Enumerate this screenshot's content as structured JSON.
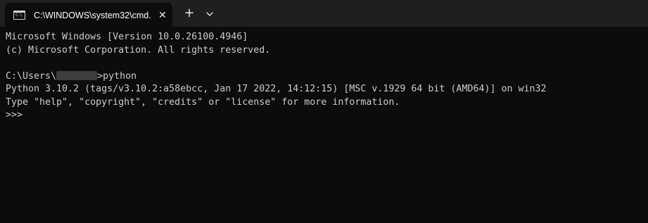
{
  "tab": {
    "title": "C:\\WINDOWS\\system32\\cmd.",
    "icon": "command-prompt-icon",
    "close_symbol": "✕"
  },
  "tabbar": {
    "new_tab_symbol": "+",
    "dropdown_icon": "chevron-down-icon"
  },
  "console": {
    "banner_line1": "Microsoft Windows [Version 10.0.26100.4946]",
    "banner_line2": "(c) Microsoft Corporation. All rights reserved.",
    "prompt_prefix": "C:\\Users\\",
    "prompt_suffix": ">python",
    "python_version_line": "Python 3.10.2 (tags/v3.10.2:a58ebcc, Jan 17 2022, 14:12:15) [MSC v.1929 64 bit (AMD64)] on win32",
    "python_help_line": "Type \"help\", \"copyright\", \"credits\" or \"license\" for more information.",
    "repl_prompt": ">>> "
  },
  "colors": {
    "console_background": "#0c0c0c",
    "tabbar_background": "#1f1f1f",
    "console_text": "#cccccc",
    "tab_text": "#ffffff"
  }
}
